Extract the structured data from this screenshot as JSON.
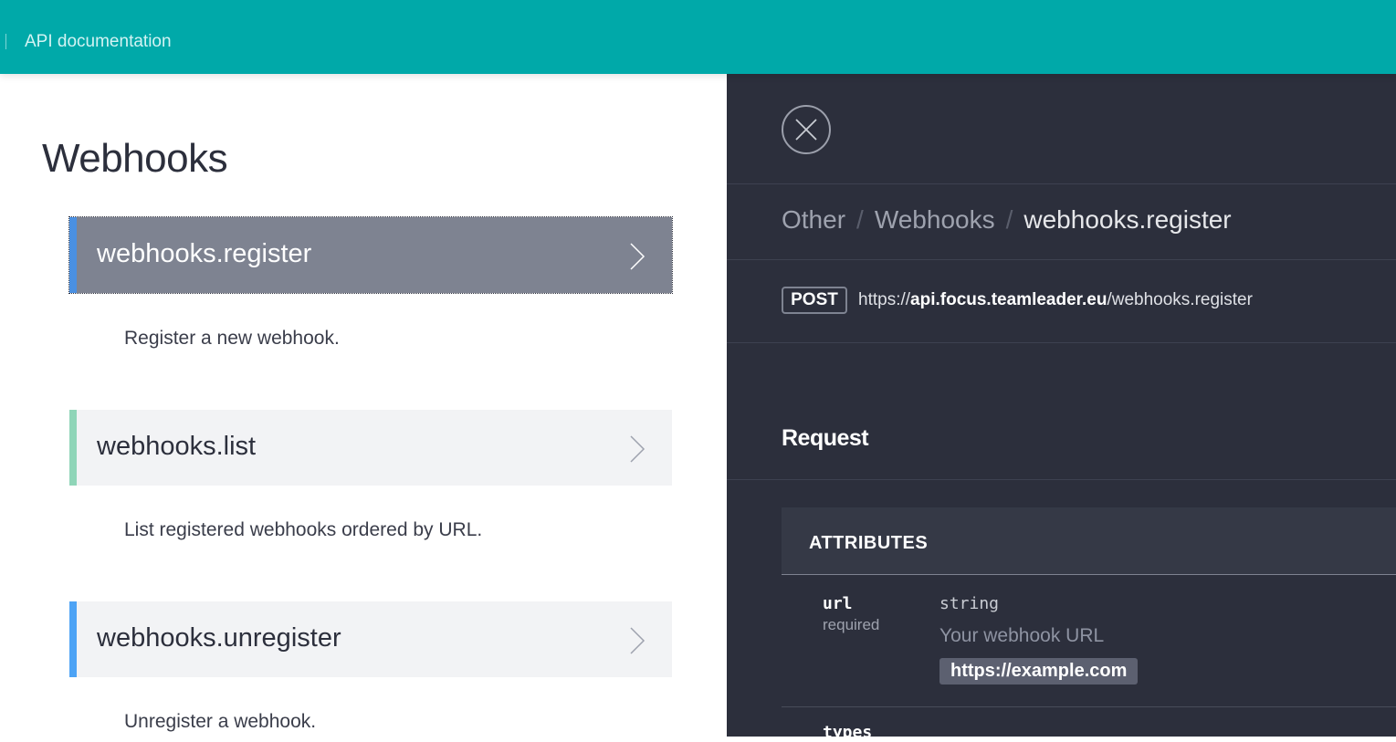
{
  "header": {
    "title": "API documentation"
  },
  "left": {
    "title": "Webhooks",
    "endpoints": [
      {
        "name": "webhooks.register",
        "description": "Register a new webhook.",
        "accent": "#4a90e2",
        "active": true
      },
      {
        "name": "webhooks.list",
        "description": "List registered webhooks ordered by URL.",
        "accent": "#8fd5b8",
        "active": false
      },
      {
        "name": "webhooks.unregister",
        "description": "Unregister a webhook.",
        "accent": "#4da3f5",
        "active": false
      }
    ]
  },
  "right": {
    "breadcrumb": [
      "Other",
      "Webhooks",
      "webhooks.register"
    ],
    "method": "POST",
    "url": {
      "prefix": "https://",
      "host": "api.focus.teamleader.eu",
      "path": "/webhooks.register"
    },
    "request_title": "Request",
    "attributes_title": "ATTRIBUTES",
    "attributes": [
      {
        "name": "url",
        "required": "required",
        "type": "string",
        "description": "Your webhook URL",
        "example": "https://example.com"
      },
      {
        "name": "types"
      }
    ]
  },
  "colors": {
    "header_bg": "#00a9a9",
    "panel_bg": "#2c2f3c",
    "active_item_bg": "#7e8391"
  }
}
